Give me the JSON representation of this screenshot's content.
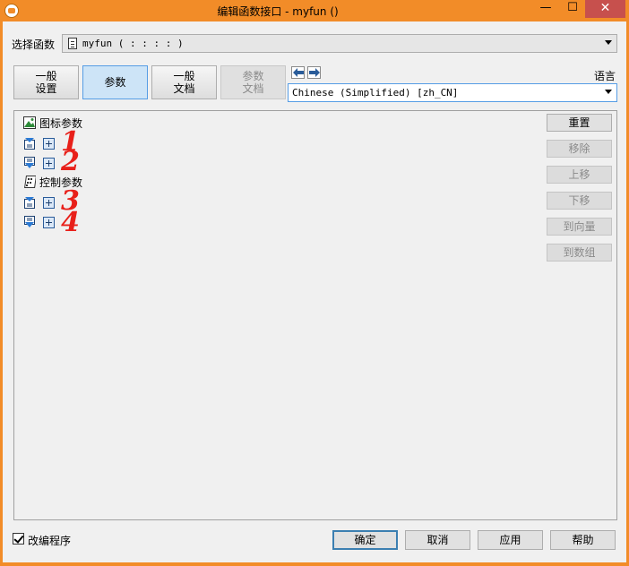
{
  "window": {
    "title": "编辑函数接口 - myfun ()",
    "controls": {
      "minimize": "—",
      "maximize": "☐",
      "close": "✕"
    }
  },
  "function_select": {
    "label": "选择函数",
    "value": "myfun ( : : : : )"
  },
  "tabs": [
    {
      "label": "一般\n设置",
      "state": "normal"
    },
    {
      "label": "参数",
      "state": "selected"
    },
    {
      "label": "一般\n文档",
      "state": "normal"
    },
    {
      "label": "参数\n文档",
      "state": "disabled"
    }
  ],
  "language": {
    "label": "语言",
    "value": "Chinese (Simplified) [zh_CN]"
  },
  "tree": {
    "group_iconic": "图标参数",
    "group_control": "控制参数",
    "annotations": [
      "1",
      "2",
      "3",
      "4"
    ]
  },
  "side_buttons": [
    {
      "label": "重置",
      "enabled": true
    },
    {
      "label": "移除",
      "enabled": false
    },
    {
      "label": "上移",
      "enabled": false
    },
    {
      "label": "下移",
      "enabled": false
    },
    {
      "label": "到向量",
      "enabled": false
    },
    {
      "label": "到数组",
      "enabled": false
    }
  ],
  "footer": {
    "checkbox_label": "改编程序",
    "checkbox_checked": true,
    "ok": "确定",
    "cancel": "取消",
    "apply": "应用",
    "help": "帮助"
  },
  "colors": {
    "frame": "#f28c28",
    "close_button": "#c7504d",
    "annotation": "#e8201a",
    "selected_tab": "#cde4f7"
  }
}
